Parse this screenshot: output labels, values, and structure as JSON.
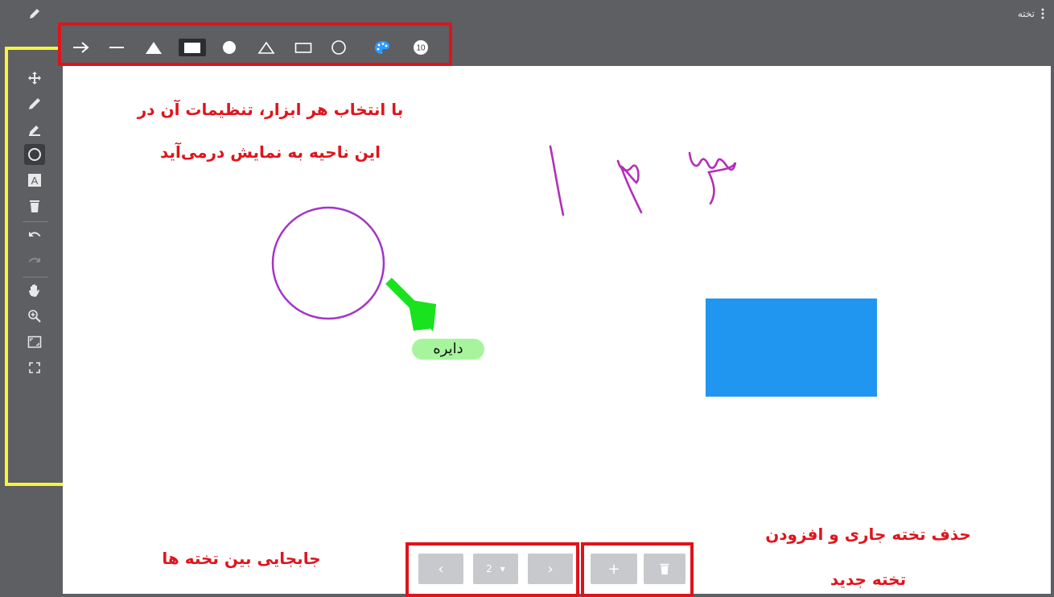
{
  "header": {
    "title": "تخته",
    "edit_icon": "pencil-icon",
    "menu_icon": "vertical-dots-icon"
  },
  "toolbar": {
    "tools": [
      {
        "name": "move",
        "icon": "move-arrows-icon",
        "active": false
      },
      {
        "name": "pencil",
        "icon": "pencil-icon",
        "active": false
      },
      {
        "name": "highlighter",
        "icon": "marker-icon",
        "active": false
      },
      {
        "name": "shape",
        "icon": "circle-shape-icon",
        "active": true
      },
      {
        "name": "text",
        "icon": "text-box-icon",
        "active": false
      },
      {
        "name": "delete",
        "icon": "trash-icon",
        "active": false
      },
      {
        "name": "undo",
        "icon": "undo-icon",
        "active": false
      },
      {
        "name": "redo",
        "icon": "redo-icon",
        "active": false,
        "disabled": true
      },
      {
        "name": "pan",
        "icon": "hand-icon",
        "active": false
      },
      {
        "name": "zoom",
        "icon": "zoom-in-icon",
        "active": false
      },
      {
        "name": "fit",
        "icon": "fit-screen-icon",
        "active": false
      },
      {
        "name": "fullscreen",
        "icon": "fullscreen-icon",
        "active": false
      }
    ]
  },
  "shape_options": {
    "items": [
      {
        "name": "arrow",
        "icon": "arrow-right-icon"
      },
      {
        "name": "line",
        "icon": "line-icon"
      },
      {
        "name": "filled-triangle",
        "icon": "filled-triangle-icon"
      },
      {
        "name": "filled-rectangle",
        "icon": "filled-rectangle-icon",
        "active": true
      },
      {
        "name": "filled-circle",
        "icon": "filled-circle-icon"
      },
      {
        "name": "outline-triangle",
        "icon": "outline-triangle-icon"
      },
      {
        "name": "outline-rectangle",
        "icon": "outline-rectangle-icon"
      },
      {
        "name": "outline-circle",
        "icon": "outline-circle-icon"
      },
      {
        "name": "color",
        "icon": "palette-icon"
      }
    ],
    "stroke_size": "10"
  },
  "canvas": {
    "annotation_top_line1": "با انتخاب هر ابزار، تنظیمات آن در",
    "annotation_top_line2": "این ناحیه به نمایش درمی‌آید",
    "circle_label": "دایره",
    "handwritten_numbers": "۱ ۲ ۳",
    "annotation_nav": "جابجایی بین تخته ها",
    "annotation_manage_line1": "حذف تخته جاری و افزودن",
    "annotation_manage_line2": "تخته جدید",
    "colors": {
      "circle": "#a335c6",
      "arrow": "#19e21e",
      "rectangle": "#2196f0",
      "numbers": "#b42dba"
    }
  },
  "navigation": {
    "prev_label": "‹",
    "page_value": "2",
    "page_caret": "▾",
    "next_label": "›",
    "add_label": "+",
    "delete_icon": "trash-icon"
  }
}
